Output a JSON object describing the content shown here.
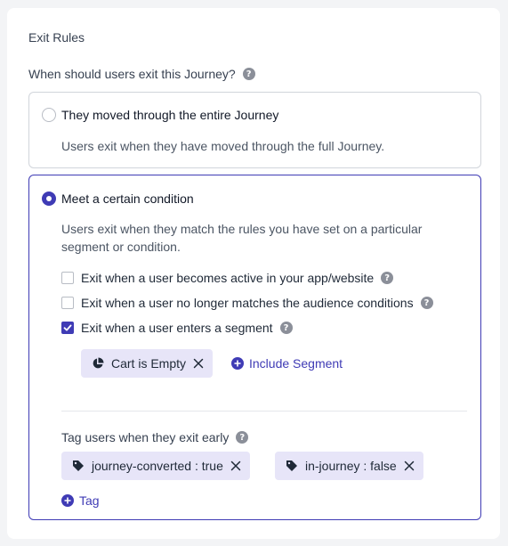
{
  "section": {
    "title": "Exit Rules",
    "question": "When should users exit this Journey?"
  },
  "options": [
    {
      "label": "They moved through the entire Journey",
      "description": "Users exit when they have moved through the full Journey.",
      "selected": false
    },
    {
      "label": "Meet a certain condition",
      "description": "Users exit when they match the rules you have set on a particular segment or condition.",
      "selected": true
    }
  ],
  "conditions": [
    {
      "label": "Exit when a user becomes active in your app/website",
      "checked": false
    },
    {
      "label": "Exit when a user no longer matches the audience conditions",
      "checked": false
    },
    {
      "label": "Exit when a user enters a segment",
      "checked": true
    }
  ],
  "segment_chip": {
    "label": "Cart is Empty",
    "icon": "pie-chart-icon"
  },
  "include_segment_label": "Include Segment",
  "tags": {
    "label": "Tag users when they exit early",
    "items": [
      "journey-converted : true",
      "in-journey : false"
    ],
    "add_label": "Tag"
  },
  "colors": {
    "accent": "#3f3bb5",
    "chip_bg": "#e7e5f8",
    "border": "#d1d5db"
  }
}
